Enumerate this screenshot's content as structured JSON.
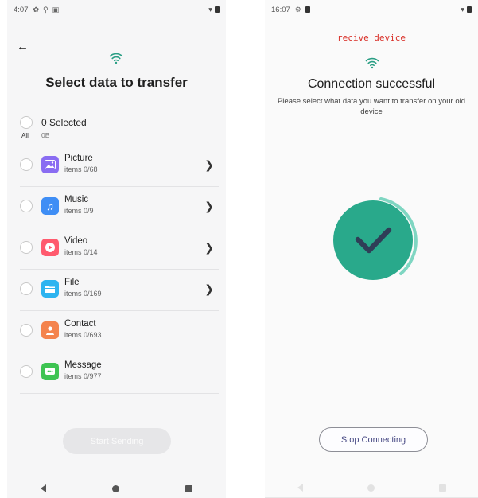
{
  "left": {
    "status": {
      "time": "4:07"
    },
    "title": "Select data to transfer",
    "selection": {
      "count_label": "0 Selected",
      "size": "0B",
      "all_label": "All"
    },
    "items": [
      {
        "name": "Picture",
        "count": "items 0/68",
        "icon": "picture-icon",
        "color": "#8a6df2",
        "has_chevron": true
      },
      {
        "name": "Music",
        "count": "items 0/9",
        "icon": "music-icon",
        "color": "#3f8ef5",
        "has_chevron": true
      },
      {
        "name": "Video",
        "count": "items 0/14",
        "icon": "video-icon",
        "color": "#ff5a6e",
        "has_chevron": true
      },
      {
        "name": "File",
        "count": "items 0/169",
        "icon": "folder-icon",
        "color": "#2db4f0",
        "has_chevron": true
      },
      {
        "name": "Contact",
        "count": "items 0/693",
        "icon": "contact-icon",
        "color": "#f4834d",
        "has_chevron": false
      },
      {
        "name": "Message",
        "count": "items 0/977",
        "icon": "message-icon",
        "color": "#3ec452",
        "has_chevron": false
      }
    ],
    "start_button": "Start Sending"
  },
  "right": {
    "status": {
      "time": "16:07"
    },
    "device_label": "recive device",
    "heading": "Connection successful",
    "subtext": "Please select what data you want to transfer on your old device",
    "stop_button": "Stop Connecting",
    "accent": "#29a98b"
  }
}
